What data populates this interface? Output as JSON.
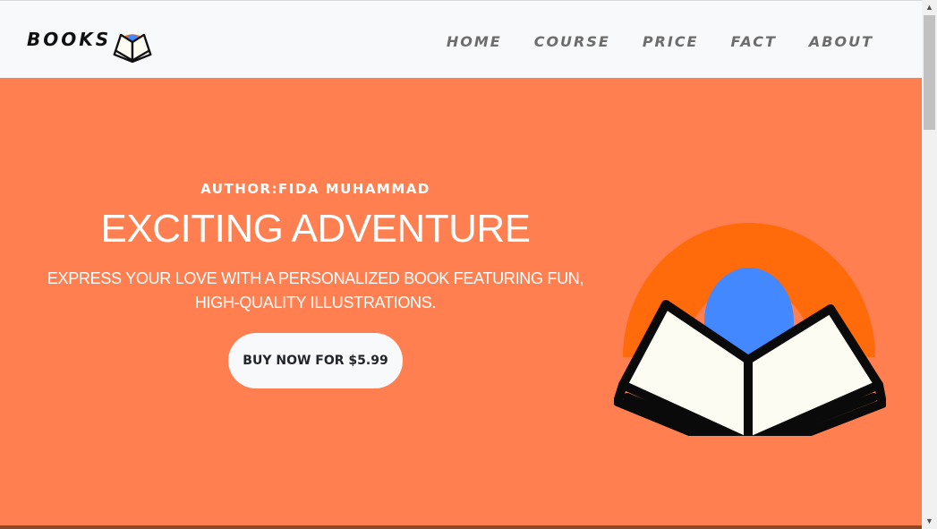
{
  "brand": {
    "name": "BOOKS",
    "logo_icon": "book-logo-icon"
  },
  "nav": {
    "items": [
      {
        "label": "HOME"
      },
      {
        "label": "COURSE"
      },
      {
        "label": "PRICE"
      },
      {
        "label": "FACT"
      },
      {
        "label": "ABOUT"
      }
    ]
  },
  "hero": {
    "author": "AUTHOR:FIDA MUHAMMAD",
    "headline": "EXCITING ADVENTURE",
    "tagline": "EXPRESS YOUR LOVE WITH A PERSONALIZED BOOK FEATURING FUN, HIGH-QUALITY ILLUSTRATIONS.",
    "button_label": "BUY NOW FOR $5.99",
    "illustration_icon": "open-book-rainbow-icon"
  },
  "colors": {
    "hero_bg": "#ff7f50",
    "navbar_bg": "#f8f9fa",
    "rainbow_orange": "#ff6a0a",
    "rainbow_blue": "#4488ff",
    "book_page": "#fdfcf3"
  }
}
